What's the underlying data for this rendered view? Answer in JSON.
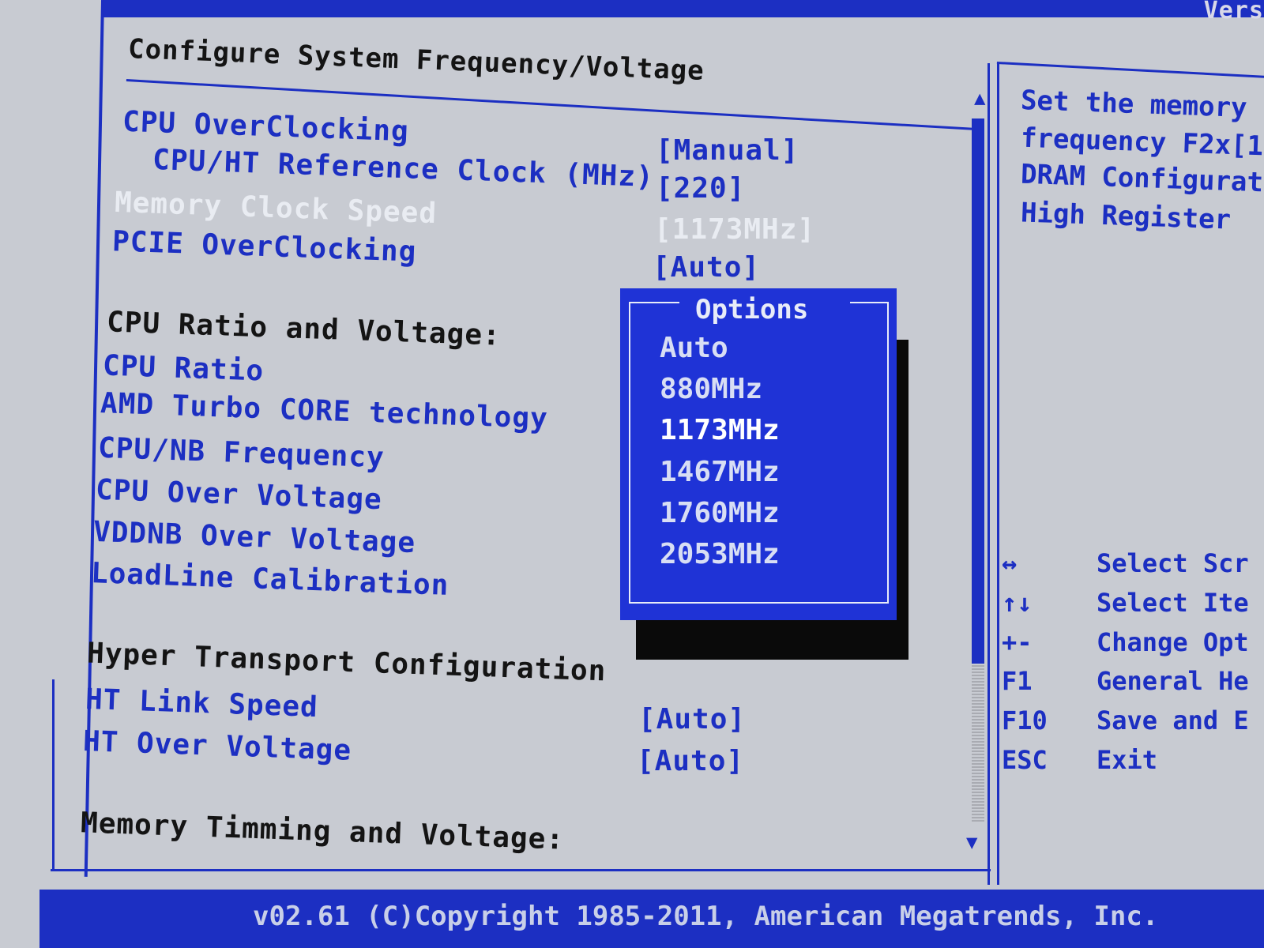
{
  "top": {
    "version_fragment": "Vers"
  },
  "header": {
    "title": "Configure System Frequency/Voltage"
  },
  "settings": {
    "cpu_overclocking": {
      "label": "CPU OverClocking",
      "value": "[Manual]"
    },
    "ref_clock": {
      "label": "CPU/HT Reference Clock (MHz)",
      "value": "[220]"
    },
    "memory_clock": {
      "label": "Memory Clock Speed",
      "value": "[1173MHz]"
    },
    "pcie_overclocking": {
      "label": "PCIE OverClocking",
      "value": "[Auto]"
    },
    "cpu_ratio_heading": "CPU Ratio and Voltage:",
    "cpu_ratio": {
      "label": "CPU Ratio"
    },
    "amd_turbo": {
      "label": "AMD Turbo CORE technology"
    },
    "cpu_nb_freq": {
      "label": "CPU/NB Frequency"
    },
    "cpu_over_voltage": {
      "label": "CPU Over Voltage"
    },
    "vddnb_over_voltage": {
      "label": "VDDNB Over Voltage"
    },
    "loadline": {
      "label": "LoadLine Calibration"
    },
    "ht_heading": "Hyper Transport Configuration",
    "ht_link_speed": {
      "label": "HT Link Speed",
      "value": "[Auto]"
    },
    "ht_over_voltage": {
      "label": "HT Over Voltage",
      "value": "[Auto]"
    },
    "memory_heading": "Memory Timming and Voltage:"
  },
  "popup": {
    "title": "Options",
    "options": [
      "Auto",
      "880MHz",
      "1173MHz",
      "1467MHz",
      "1760MHz",
      "2053MHz"
    ],
    "selected": "1173MHz"
  },
  "help": {
    "lines": [
      "Set the memory",
      "frequency F2x[1",
      "DRAM Configurat",
      "High Register"
    ]
  },
  "keys": [
    {
      "key": "↔",
      "desc": "Select Scr"
    },
    {
      "key": "↑↓",
      "desc": "Select Ite"
    },
    {
      "key": "+-",
      "desc": "Change Opt"
    },
    {
      "key": "F1",
      "desc": "General He"
    },
    {
      "key": "F10",
      "desc": "Save and E"
    },
    {
      "key": "ESC",
      "desc": "Exit"
    }
  ],
  "footer": {
    "copyright": "v02.61 (C)Copyright 1985-2011, American Megatrends, Inc."
  },
  "colors": {
    "bios_blue": "#1c2fc2",
    "background": "#c8cbd2",
    "popup_blue": "#1f33d6"
  }
}
